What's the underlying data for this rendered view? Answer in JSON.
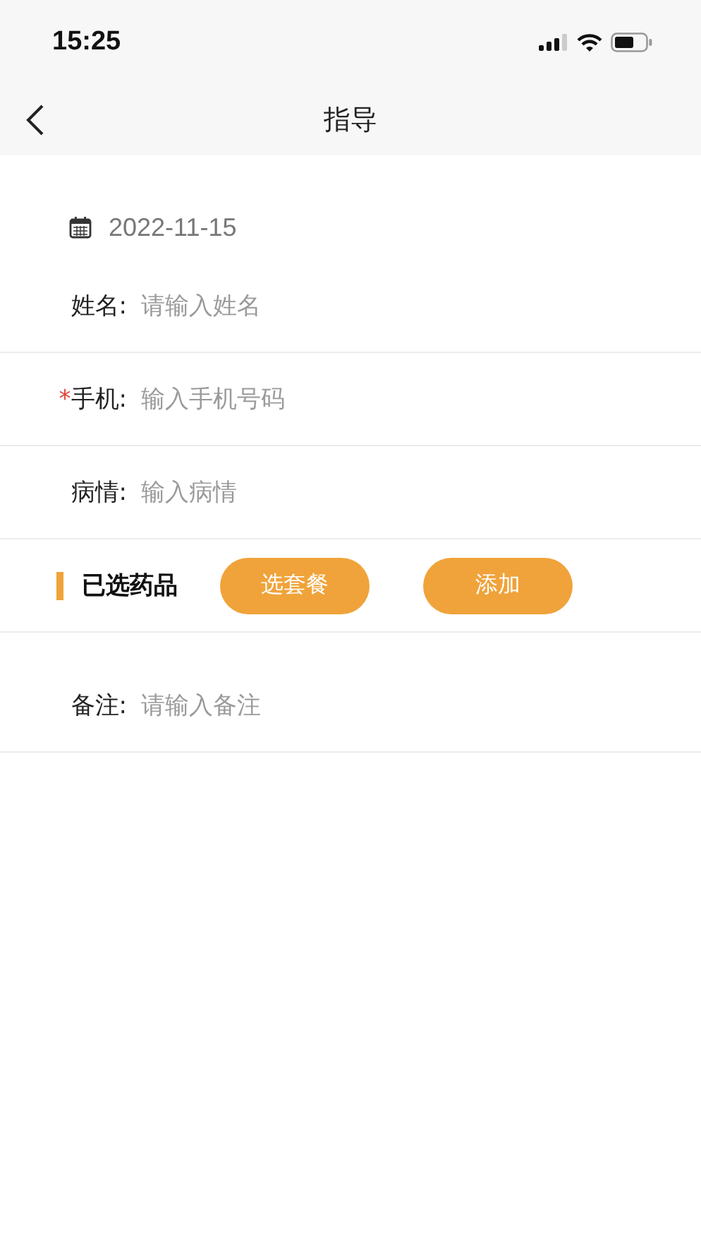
{
  "status_bar": {
    "time": "15:25"
  },
  "nav": {
    "title": "指导"
  },
  "date": "2022-11-15",
  "fields": [
    {
      "label": "姓名:",
      "placeholder": "请输入姓名"
    },
    {
      "label": "手机:",
      "placeholder": "输入手机号码",
      "required_mark": "*"
    },
    {
      "label": "病情:",
      "placeholder": "输入病情"
    }
  ],
  "medicines": {
    "title": "已选药品",
    "buttons": [
      "选套餐",
      "添加"
    ]
  },
  "note": {
    "label": "备注:",
    "placeholder": "请输入备注"
  }
}
